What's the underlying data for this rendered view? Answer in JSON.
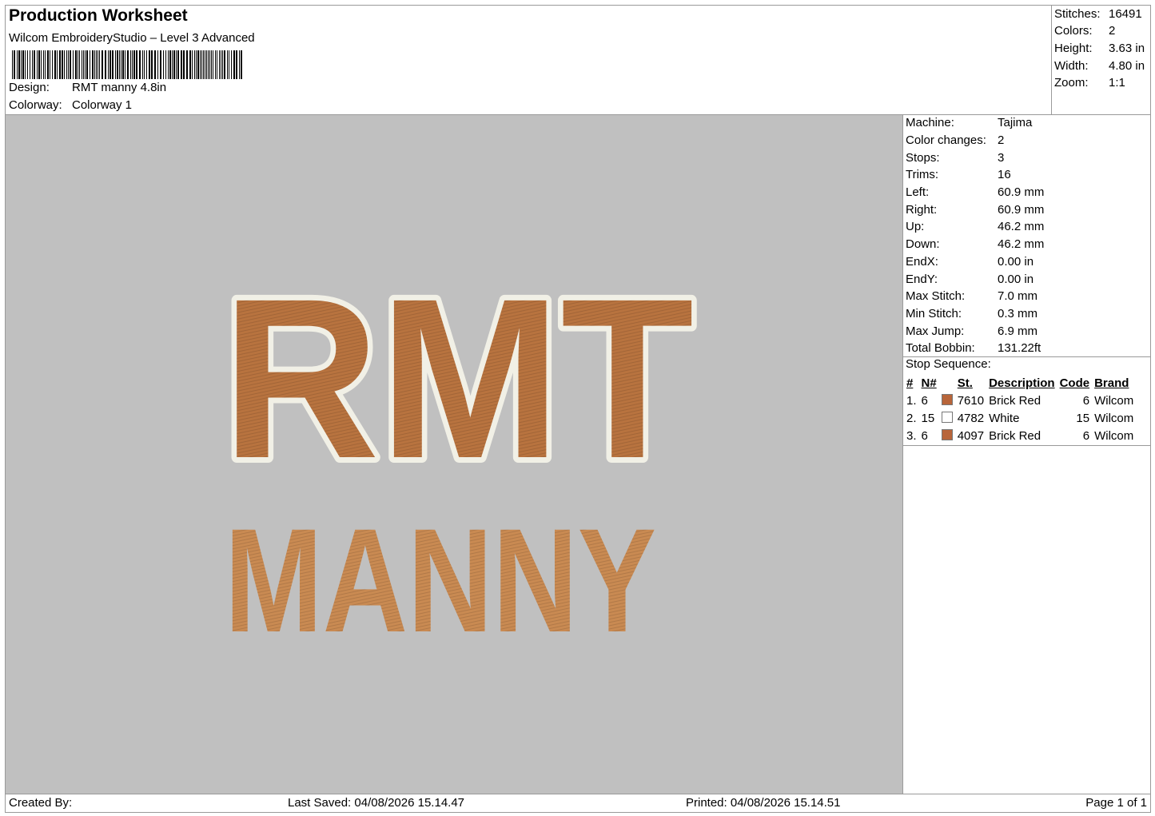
{
  "header": {
    "title": "Production Worksheet",
    "software": "Wilcom EmbroideryStudio – Level 3 Advanced",
    "design_label": "Design:",
    "design_value": "RMT manny 4.8in",
    "colorway_label": "Colorway:",
    "colorway_value": "Colorway 1"
  },
  "summary": [
    {
      "label": "Stitches:",
      "value": "16491"
    },
    {
      "label": "Colors:",
      "value": "2"
    },
    {
      "label": "Height:",
      "value": "3.63 in"
    },
    {
      "label": "Width:",
      "value": "4.80 in"
    },
    {
      "label": "Zoom:",
      "value": "1:1"
    }
  ],
  "design_preview": {
    "line1": "RMT",
    "line2": "MANNY",
    "fill_color": "#b8733f",
    "outline_color": "#f1f0e6",
    "manny_color": "#c98a52",
    "background": "#c0c0c0"
  },
  "machine": [
    {
      "label": "Machine:",
      "value": "Tajima"
    },
    {
      "label": "Color changes:",
      "value": "2"
    },
    {
      "label": "Stops:",
      "value": "3"
    },
    {
      "label": "Trims:",
      "value": "16"
    },
    {
      "label": "Left:",
      "value": "60.9 mm"
    },
    {
      "label": "Right:",
      "value": "60.9 mm"
    },
    {
      "label": "Up:",
      "value": "46.2 mm"
    },
    {
      "label": "Down:",
      "value": "46.2 mm"
    },
    {
      "label": "EndX:",
      "value": "0.00 in"
    },
    {
      "label": "EndY:",
      "value": "0.00 in"
    },
    {
      "label": "Max Stitch:",
      "value": "7.0 mm"
    },
    {
      "label": "Min Stitch:",
      "value": "0.3 mm"
    },
    {
      "label": "Max Jump:",
      "value": "6.9 mm"
    },
    {
      "label": "Total Bobbin:",
      "value": "131.22ft"
    }
  ],
  "stop_sequence": {
    "title": "Stop Sequence:",
    "columns": [
      "#",
      "N#",
      "St.",
      "Description",
      "Code",
      "Brand"
    ],
    "rows": [
      {
        "idx": "1.",
        "n": "6",
        "swatch": "#b8653a",
        "st": "7610",
        "desc": "Brick Red",
        "code": "6",
        "brand": "Wilcom"
      },
      {
        "idx": "2.",
        "n": "15",
        "swatch": "#ffffff",
        "st": "4782",
        "desc": "White",
        "code": "15",
        "brand": "Wilcom"
      },
      {
        "idx": "3.",
        "n": "6",
        "swatch": "#b8653a",
        "st": "4097",
        "desc": "Brick Red",
        "code": "6",
        "brand": "Wilcom"
      }
    ]
  },
  "footer": {
    "created_by": "Created By:",
    "last_saved": "Last Saved: 04/08/2026 15.14.47",
    "printed": "Printed: 04/08/2026 15.14.51",
    "page": "Page 1 of 1"
  }
}
